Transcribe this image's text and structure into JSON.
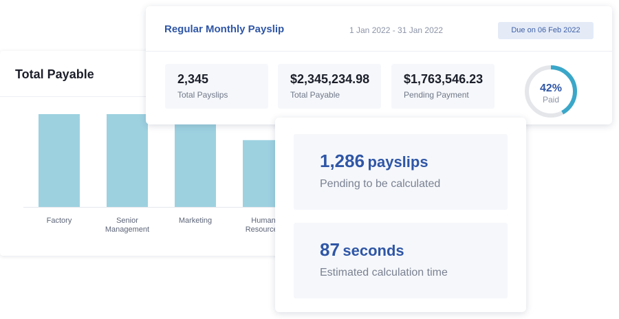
{
  "total_payable": {
    "title": "Total Payable",
    "chart_data": {
      "type": "bar",
      "categories": [
        "Factory",
        "Senior Management",
        "Marketing",
        "Human Resources"
      ],
      "category_lines": [
        [
          "Factory"
        ],
        [
          "Senior",
          "Management"
        ],
        [
          "Marketing"
        ],
        [
          "Human",
          "Resources"
        ]
      ],
      "values": [
        100,
        100,
        89,
        72
      ],
      "ylim": [
        0,
        100
      ],
      "grid": false,
      "bar_color": "#9dd1e0"
    }
  },
  "payslip": {
    "title": "Regular Monthly Payslip",
    "period": "1 Jan 2022 - 31 Jan 2022",
    "due": "Due on 06 Feb 2022",
    "stats": [
      {
        "value": "2,345",
        "label": "Total Payslips"
      },
      {
        "value": "$2,345,234.98",
        "label": "Total Payable"
      },
      {
        "value": "$1,763,546.23",
        "label": "Pending Payment"
      }
    ],
    "paid": {
      "percent": 42,
      "percent_label": "42%",
      "label": "Paid",
      "color": "#3aa7c9",
      "track_color": "#e4e6ea"
    }
  },
  "calculation": {
    "pending": {
      "number": "1,286",
      "unit": "payslips",
      "label": "Pending to be calculated"
    },
    "time": {
      "number": "87",
      "unit": "seconds",
      "label": "Estimated calculation time"
    }
  }
}
